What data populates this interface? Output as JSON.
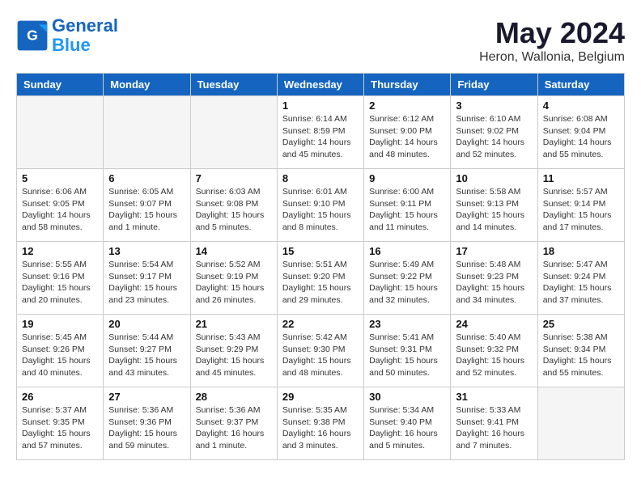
{
  "header": {
    "logo_line1": "General",
    "logo_line2": "Blue",
    "month_year": "May 2024",
    "location": "Heron, Wallonia, Belgium"
  },
  "weekdays": [
    "Sunday",
    "Monday",
    "Tuesday",
    "Wednesday",
    "Thursday",
    "Friday",
    "Saturday"
  ],
  "weeks": [
    [
      {
        "day": "",
        "info": ""
      },
      {
        "day": "",
        "info": ""
      },
      {
        "day": "",
        "info": ""
      },
      {
        "day": "1",
        "info": "Sunrise: 6:14 AM\nSunset: 8:59 PM\nDaylight: 14 hours\nand 45 minutes."
      },
      {
        "day": "2",
        "info": "Sunrise: 6:12 AM\nSunset: 9:00 PM\nDaylight: 14 hours\nand 48 minutes."
      },
      {
        "day": "3",
        "info": "Sunrise: 6:10 AM\nSunset: 9:02 PM\nDaylight: 14 hours\nand 52 minutes."
      },
      {
        "day": "4",
        "info": "Sunrise: 6:08 AM\nSunset: 9:04 PM\nDaylight: 14 hours\nand 55 minutes."
      }
    ],
    [
      {
        "day": "5",
        "info": "Sunrise: 6:06 AM\nSunset: 9:05 PM\nDaylight: 14 hours\nand 58 minutes."
      },
      {
        "day": "6",
        "info": "Sunrise: 6:05 AM\nSunset: 9:07 PM\nDaylight: 15 hours\nand 1 minute."
      },
      {
        "day": "7",
        "info": "Sunrise: 6:03 AM\nSunset: 9:08 PM\nDaylight: 15 hours\nand 5 minutes."
      },
      {
        "day": "8",
        "info": "Sunrise: 6:01 AM\nSunset: 9:10 PM\nDaylight: 15 hours\nand 8 minutes."
      },
      {
        "day": "9",
        "info": "Sunrise: 6:00 AM\nSunset: 9:11 PM\nDaylight: 15 hours\nand 11 minutes."
      },
      {
        "day": "10",
        "info": "Sunrise: 5:58 AM\nSunset: 9:13 PM\nDaylight: 15 hours\nand 14 minutes."
      },
      {
        "day": "11",
        "info": "Sunrise: 5:57 AM\nSunset: 9:14 PM\nDaylight: 15 hours\nand 17 minutes."
      }
    ],
    [
      {
        "day": "12",
        "info": "Sunrise: 5:55 AM\nSunset: 9:16 PM\nDaylight: 15 hours\nand 20 minutes."
      },
      {
        "day": "13",
        "info": "Sunrise: 5:54 AM\nSunset: 9:17 PM\nDaylight: 15 hours\nand 23 minutes."
      },
      {
        "day": "14",
        "info": "Sunrise: 5:52 AM\nSunset: 9:19 PM\nDaylight: 15 hours\nand 26 minutes."
      },
      {
        "day": "15",
        "info": "Sunrise: 5:51 AM\nSunset: 9:20 PM\nDaylight: 15 hours\nand 29 minutes."
      },
      {
        "day": "16",
        "info": "Sunrise: 5:49 AM\nSunset: 9:22 PM\nDaylight: 15 hours\nand 32 minutes."
      },
      {
        "day": "17",
        "info": "Sunrise: 5:48 AM\nSunset: 9:23 PM\nDaylight: 15 hours\nand 34 minutes."
      },
      {
        "day": "18",
        "info": "Sunrise: 5:47 AM\nSunset: 9:24 PM\nDaylight: 15 hours\nand 37 minutes."
      }
    ],
    [
      {
        "day": "19",
        "info": "Sunrise: 5:45 AM\nSunset: 9:26 PM\nDaylight: 15 hours\nand 40 minutes."
      },
      {
        "day": "20",
        "info": "Sunrise: 5:44 AM\nSunset: 9:27 PM\nDaylight: 15 hours\nand 43 minutes."
      },
      {
        "day": "21",
        "info": "Sunrise: 5:43 AM\nSunset: 9:29 PM\nDaylight: 15 hours\nand 45 minutes."
      },
      {
        "day": "22",
        "info": "Sunrise: 5:42 AM\nSunset: 9:30 PM\nDaylight: 15 hours\nand 48 minutes."
      },
      {
        "day": "23",
        "info": "Sunrise: 5:41 AM\nSunset: 9:31 PM\nDaylight: 15 hours\nand 50 minutes."
      },
      {
        "day": "24",
        "info": "Sunrise: 5:40 AM\nSunset: 9:32 PM\nDaylight: 15 hours\nand 52 minutes."
      },
      {
        "day": "25",
        "info": "Sunrise: 5:38 AM\nSunset: 9:34 PM\nDaylight: 15 hours\nand 55 minutes."
      }
    ],
    [
      {
        "day": "26",
        "info": "Sunrise: 5:37 AM\nSunset: 9:35 PM\nDaylight: 15 hours\nand 57 minutes."
      },
      {
        "day": "27",
        "info": "Sunrise: 5:36 AM\nSunset: 9:36 PM\nDaylight: 15 hours\nand 59 minutes."
      },
      {
        "day": "28",
        "info": "Sunrise: 5:36 AM\nSunset: 9:37 PM\nDaylight: 16 hours\nand 1 minute."
      },
      {
        "day": "29",
        "info": "Sunrise: 5:35 AM\nSunset: 9:38 PM\nDaylight: 16 hours\nand 3 minutes."
      },
      {
        "day": "30",
        "info": "Sunrise: 5:34 AM\nSunset: 9:40 PM\nDaylight: 16 hours\nand 5 minutes."
      },
      {
        "day": "31",
        "info": "Sunrise: 5:33 AM\nSunset: 9:41 PM\nDaylight: 16 hours\nand 7 minutes."
      },
      {
        "day": "",
        "info": ""
      }
    ]
  ]
}
